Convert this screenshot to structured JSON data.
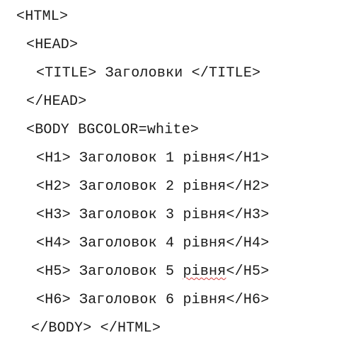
{
  "code_lines": [
    {
      "text": "<HTML>"
    },
    {
      "text": "<HEAD>"
    },
    {
      "text": "<TITLE> Заголовки </TITLE>"
    },
    {
      "text": "</HEAD>"
    },
    {
      "text": "<BODY BGCOLOR=white>"
    },
    {
      "prefix": "<H1> Заголовок 1 ",
      "word": "рівня",
      "suffix": "</H1>"
    },
    {
      "prefix": "<H2> Заголовок 2 ",
      "word": "рівня",
      "suffix": "</H2>"
    },
    {
      "prefix": "<H3> Заголовок 3 ",
      "word": "рівня",
      "suffix": "</H3>"
    },
    {
      "prefix": "<H4> Заголовок 4 ",
      "word": "рівня",
      "suffix": "</H4>"
    },
    {
      "prefix": "<H5> Заголовок 5 ",
      "word": "рівня",
      "suffix": "</H5>"
    },
    {
      "prefix": "<H6> Заголовок 6 ",
      "word": "рівня",
      "suffix": "</H6>"
    },
    {
      "text": "</BODY> </HTML>"
    }
  ]
}
